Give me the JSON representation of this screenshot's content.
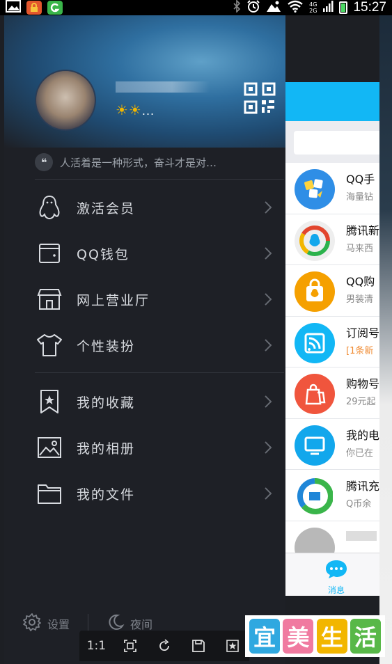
{
  "status_bar": {
    "time": "15:27",
    "network_top": "4G",
    "network_bottom": "2G"
  },
  "drawer": {
    "level_suffix": "...",
    "signature": "人活着是一种形式，奋斗才是对…",
    "menu_group1": [
      {
        "label": "激活会员",
        "icon": "penguin-icon"
      },
      {
        "label": "QQ钱包",
        "icon": "wallet-icon"
      },
      {
        "label": "网上营业厅",
        "icon": "store-icon"
      },
      {
        "label": "个性装扮",
        "icon": "tshirt-icon"
      }
    ],
    "menu_group2": [
      {
        "label": "我的收藏",
        "icon": "bookmark-icon"
      },
      {
        "label": "我的相册",
        "icon": "photo-icon"
      },
      {
        "label": "我的文件",
        "icon": "folder-icon"
      }
    ],
    "footer": {
      "settings": "设置",
      "night": "夜间"
    }
  },
  "chat_list": [
    {
      "title": "QQ手",
      "subtitle": "海量钻",
      "color": "#2f8ee6"
    },
    {
      "title": "腾讯新",
      "subtitle": "马来西",
      "color": "#e8e8e8"
    },
    {
      "title": "QQ购",
      "subtitle": "男装清",
      "color": "#f5a000"
    },
    {
      "title": "订阅号",
      "subtitle": "[1条新",
      "color": "#12b7f5"
    },
    {
      "title": "购物号",
      "subtitle": "29元起",
      "color": "#f0553d"
    },
    {
      "title": "我的电",
      "subtitle": "你已在",
      "color": "#12a7ec"
    },
    {
      "title": "腾讯充",
      "subtitle": "Q币余",
      "color": "#ffffff"
    }
  ],
  "tabbar": {
    "messages": "消息"
  },
  "viewer_toolbar": {
    "zoom": "1:1"
  },
  "watermark": {
    "chars": [
      "宜",
      "美",
      "生",
      "活"
    ],
    "colors": [
      "#2fa8e0",
      "#f07aa0",
      "#f2b600",
      "#58b848"
    ]
  },
  "colors": {
    "accent": "#12b7f5",
    "drawer_bg": "#1e2026",
    "level_star": "#f2b600"
  }
}
